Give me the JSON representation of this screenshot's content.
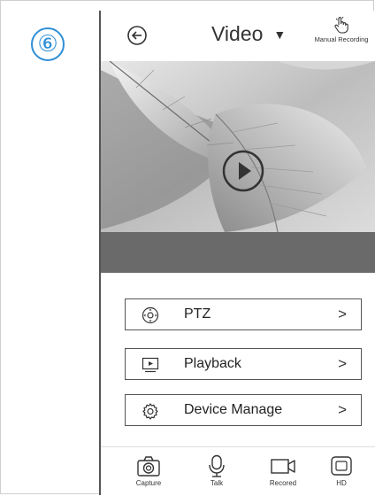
{
  "step_badge": "⑥",
  "header": {
    "title": "Video",
    "manual_recording_label": "Manual Recording"
  },
  "menu": [
    {
      "label": "PTZ",
      "icon": "ptz-icon",
      "chevron": ">"
    },
    {
      "label": "Playback",
      "icon": "playback-icon",
      "chevron": ">"
    },
    {
      "label": "Device Manage",
      "icon": "gear-icon",
      "chevron": ">"
    }
  ],
  "toolbar": [
    {
      "label": "Capture",
      "icon": "camera-icon"
    },
    {
      "label": "Talk",
      "icon": "microphone-icon"
    },
    {
      "label": "Recored",
      "icon": "video-camera-icon"
    },
    {
      "label": "HD",
      "icon": "hd-icon"
    }
  ],
  "colors": {
    "badge": "#2f8fd6",
    "video_bar": "#6a6a6a"
  }
}
